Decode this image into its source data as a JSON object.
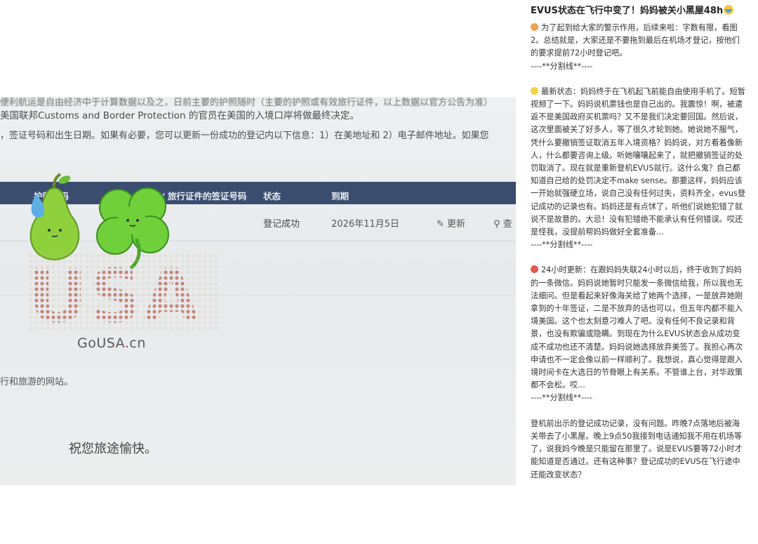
{
  "photo": {
    "top_partial": "便利航运是自由经济中于计算数据以及之，日前主要的护照随时（主要的护照或有效旅行证件，以上数据以官方公告为准）",
    "line1": "美国联邦Customs and Border Protection 的官员在美国的入境口岸将做最终决定。",
    "line2": "，签证号码和出生日期。如果有必要，您可以更新一份成功的登记内以下信息：1）在美地址和 2）电子邮件地址。如果您",
    "table": {
      "headers": [
        "护照号码",
        "/ 旅行证件的签证号码",
        "状态",
        "到期"
      ],
      "status": "登记成功",
      "date": "2026年11月5日",
      "update": "更新",
      "query": "查"
    },
    "brand": {
      "logo_text": "USA",
      "site_text": "GoUSA",
      "site_dot": ".",
      "site_tld": "cn"
    },
    "website_line": "行和旅游的网站。",
    "farewell": "祝您旅途愉快。"
  },
  "post": {
    "title": "EVUS状态在飞行中变了！妈妈被关小黑屋48h",
    "p1": "为了起到给大家的警示作用，后续来啦：字数有限，看图2。总结就是，大家还是不要拖到最后在机场才登记，按他们的要求提前72小时登记吧。",
    "sep1": "----**分割线**----",
    "p2": "最新状态：妈妈终于在飞机起飞前能自由使用手机了。短暂视频了一下。妈妈说机票钱也是自己出的。我震惊！啊，被遣返不是美国政府买机票吗？又不是我们决定要回国。然后说，这次里面被关了好多人，等了很久才轮到她。她说她不服气，凭什么要撤销签证取消五年入境资格？妈妈说，对方看着像新人，什么都要咨询上级。听她嚷嚷起来了，就把撤销签证的处罚取消了。现在就是重新登机EVUS就行。这什么鬼？自己都知道自己给的处罚决定不make sense。那要这样，妈妈应该一开始就强硬立场，说自己没有任何过失，资料齐全，evus登记成功的记录也有。妈妈还是有点怵了，听他们说她犯错了就说不是故意的。大忌！没有犯错绝不能承认有任何错误。哎还是怪我，没提前帮妈妈做好全套准备...",
    "sep2": "----**分割线**----",
    "p3": "24小时更新：在跟妈妈失联24小时以后，终于收到了妈妈的一条微信。妈妈说她暂时只能发一条微信给我，所以我也无法细问。但是看起来好像海关给了她两个选择，一是放弃她刚拿到的十年签证，二是不放弃的话也可以，但五年内都不能入境美国。这个也太刻意刁难人了吧。没有任何不良记录和背景，也没有欺骗或隐瞒。到现在为什么EVUS状态会从成功变成不成功也还不清楚。妈妈说她选择放弃美签了。我担心再次申请也不一定会像以前一样顺利了。我想说，真心觉得是跟入境时间卡在大选日的节骨眼上有关系。不管谁上台，对华政策都不会松。哎...",
    "sep3": "----**分割线**----",
    "p4": "登机前出示的登记成功记录，没有问题。昨晚7点落地后被海关带去了小黑屋。晚上9点50我接到电话通知我不用在机场等了，说我妈今晚是只能留在那里了。说是EVUS要等72小时才能知道是否通过。还有这种事？登记成功的EVUS在飞行途中还能改变状态？"
  },
  "colors": {
    "table_header": "#3a4d6f",
    "gousa_dot": "#c0392b"
  }
}
